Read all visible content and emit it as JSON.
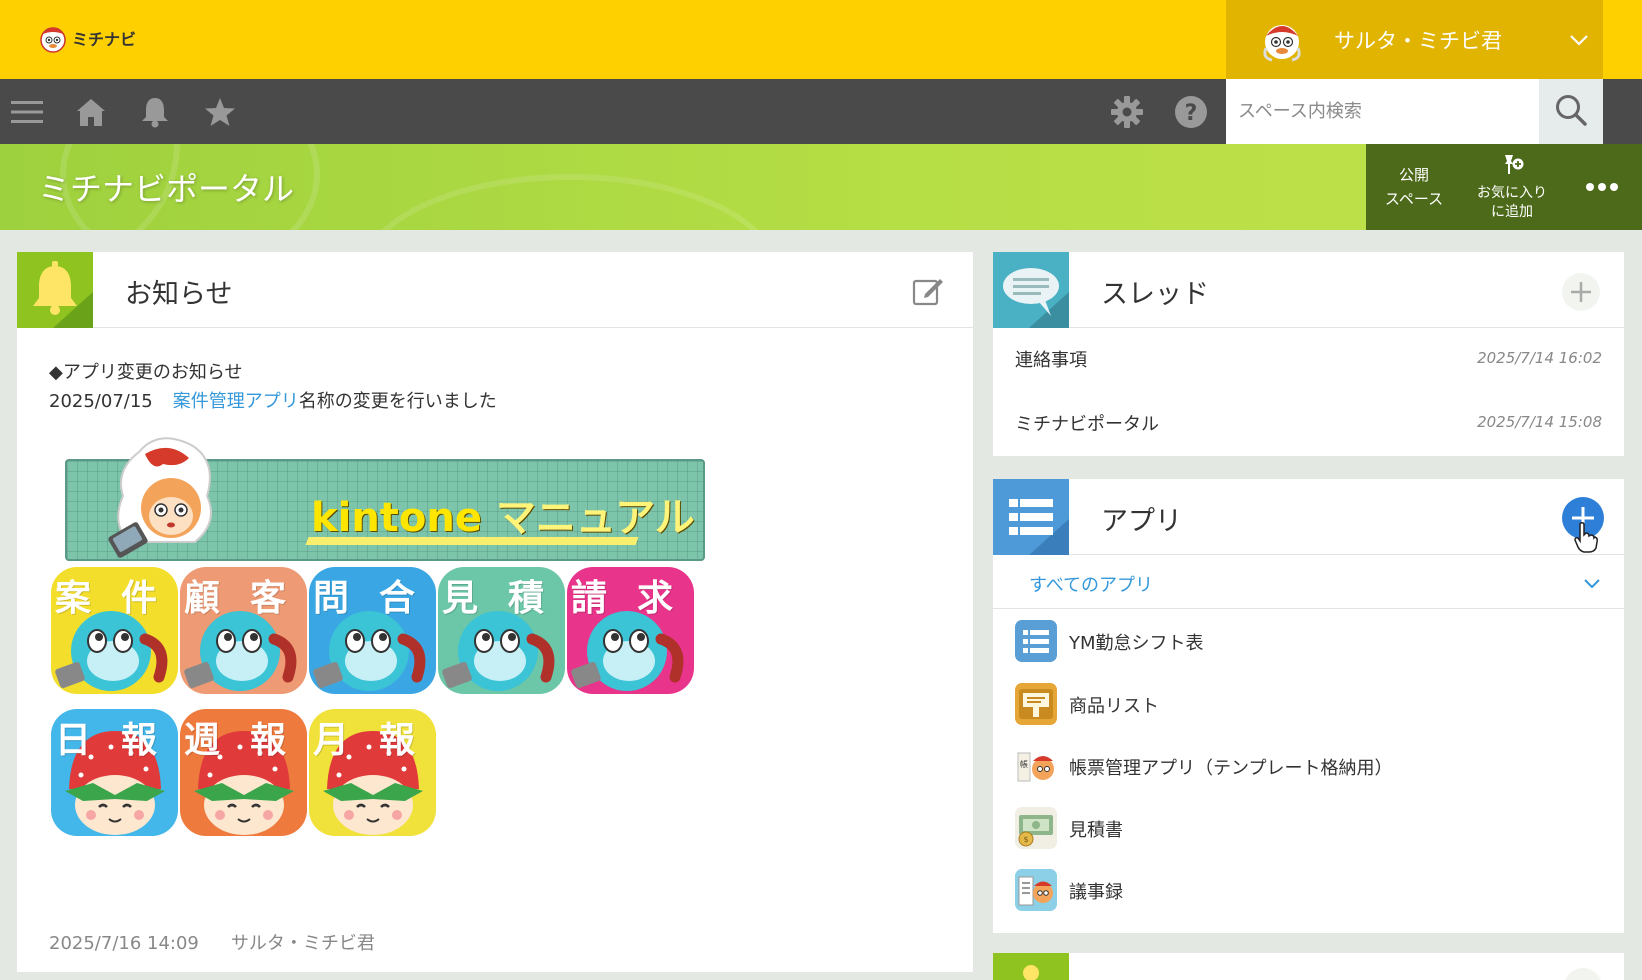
{
  "header": {
    "logo_text": "ミチナビ",
    "user_name": "サルタ・ミチビ君",
    "search_placeholder": "スペース内検索"
  },
  "space": {
    "title": "ミチナビポータル",
    "public_label_1": "公開",
    "public_label_2": "スペース",
    "favorite_label_1": "お気に入り",
    "favorite_label_2": "に追加"
  },
  "notice": {
    "title": "お知らせ",
    "heading": "◆アプリ変更のお知らせ",
    "date": "2025/07/15",
    "link_text": "案件管理アプリ",
    "message_rest": "名称の変更を行いました",
    "banner_en": "kintone",
    "banner_ja": "マニュアル",
    "tiles_row1": [
      "案件",
      "顧客",
      "問合",
      "見積",
      "請求"
    ],
    "tiles_row2": [
      "日報",
      "週報",
      "月報"
    ],
    "footer_time": "2025/7/16 14:09",
    "footer_author": "サルタ・ミチビ君"
  },
  "threads": {
    "title": "スレッド",
    "items": [
      {
        "name": "連絡事項",
        "date": "2025/7/14 16:02"
      },
      {
        "name": "ミチナビポータル",
        "date": "2025/7/14 15:08"
      }
    ]
  },
  "apps": {
    "title": "アプリ",
    "filter": "すべてのアプリ",
    "items": [
      {
        "name": "YM勤怠シフト表",
        "icon": "list-icon"
      },
      {
        "name": "商品リスト",
        "icon": "box-icon"
      },
      {
        "name": "帳票管理アプリ（テンプレート格納用）",
        "icon": "mascot-icon"
      },
      {
        "name": "見積書",
        "icon": "money-icon"
      },
      {
        "name": "議事録",
        "icon": "minutes-icon"
      }
    ]
  },
  "colors": {
    "header_yellow": "#ffd000",
    "nav_gray": "#4a4a4a",
    "space_green": "#b6de45",
    "link_blue": "#3498db",
    "add_button_blue": "#2d7fd8"
  }
}
